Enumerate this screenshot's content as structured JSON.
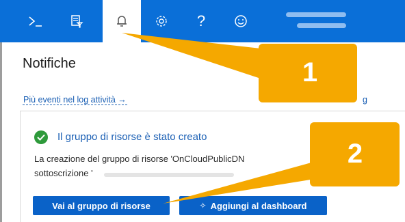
{
  "toolbar": {
    "items": [
      {
        "name": "cloud-shell-icon",
        "glyph": ">_"
      },
      {
        "name": "directory-filter-icon",
        "glyph": "⧉"
      },
      {
        "name": "notifications-bell-icon",
        "glyph": "🔔"
      },
      {
        "name": "settings-gear-icon",
        "glyph": "⚙"
      },
      {
        "name": "help-icon",
        "glyph": "?"
      },
      {
        "name": "feedback-smiley-icon",
        "glyph": "☺"
      }
    ],
    "color": "#0a6fd8"
  },
  "panel": {
    "title": "Notifiche",
    "log_link": "Più eventi nel log attività →",
    "right_fragment": "g"
  },
  "notification": {
    "title": "Il gruppo di risorse è stato creato",
    "body_line1": "La creazione del gruppo di risorse 'OnCloudPublicDN",
    "body_line2": "sottoscrizione '",
    "status_color": "#2e9a3b"
  },
  "actions": {
    "primary": "Vai al gruppo di risorse",
    "secondary": "Aggiungi al dashboard",
    "secondary_icon": "pin-icon"
  },
  "callouts": [
    {
      "label": "1",
      "color": "#f5a800"
    },
    {
      "label": "2",
      "color": "#f5a800"
    }
  ]
}
